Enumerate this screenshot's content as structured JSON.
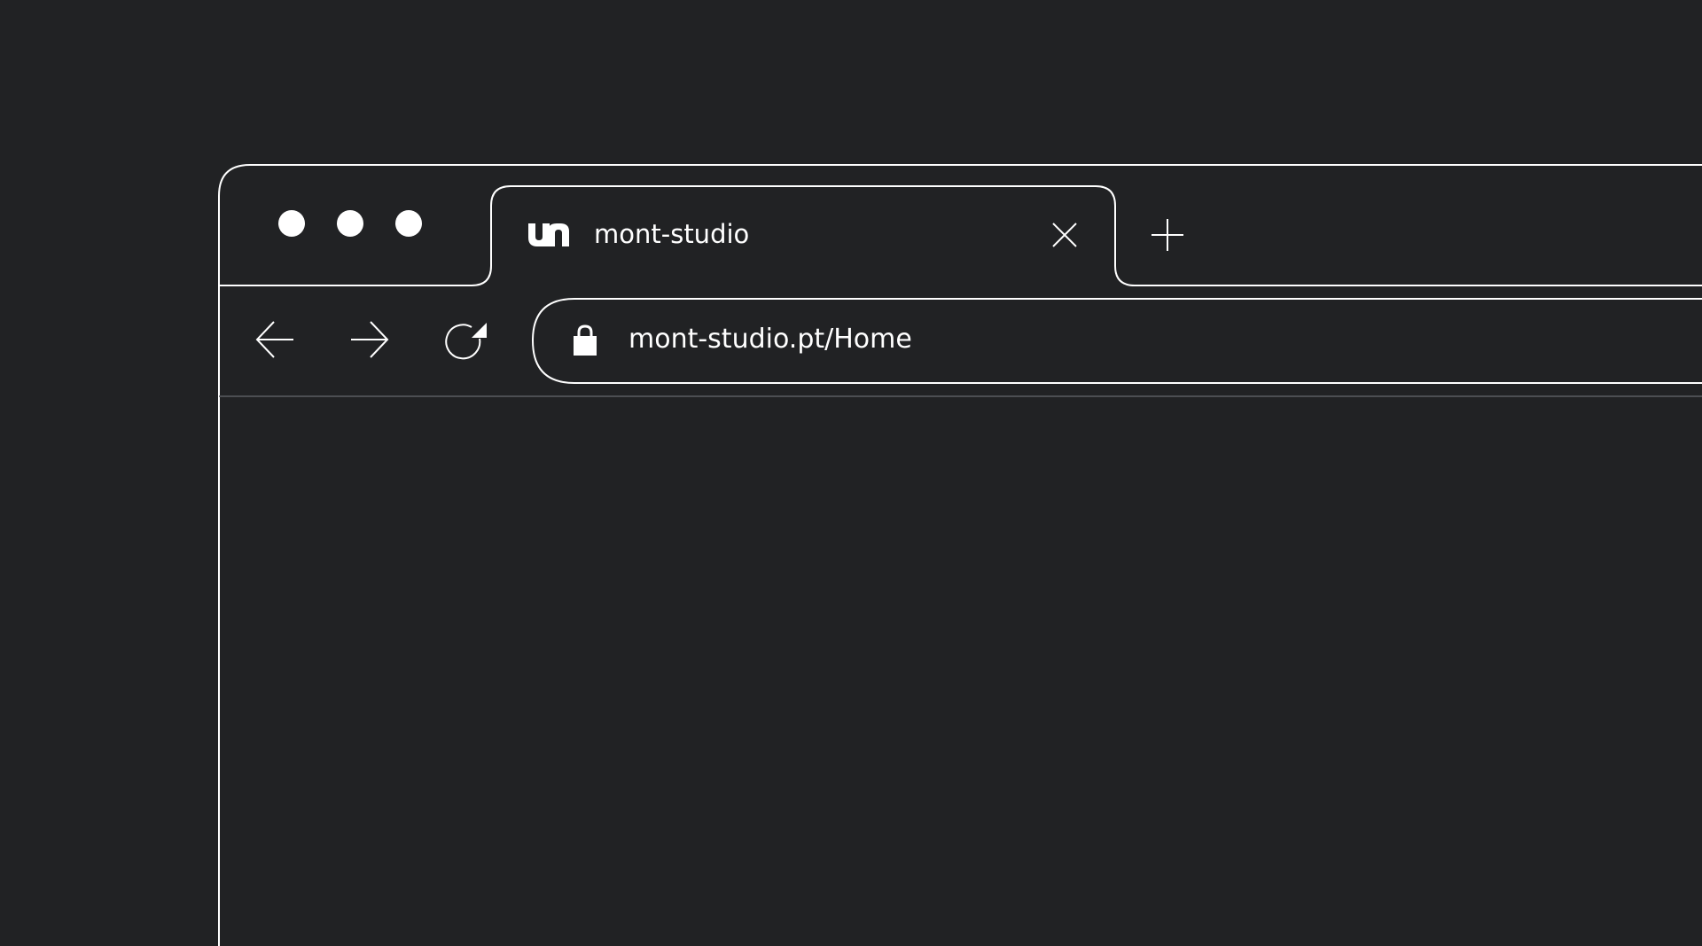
{
  "colors": {
    "background": "#212224",
    "stroke": "#ffffff",
    "divider": "#5b5d61"
  },
  "window_controls": [
    "close-dot",
    "minimize-dot",
    "zoom-dot"
  ],
  "tabs": [
    {
      "label": "mont-studio",
      "favicon": "mont-studio-logo-icon",
      "close_icon": "close-icon",
      "active": true
    }
  ],
  "new_tab_icon": "plus-icon",
  "toolbar": {
    "back_icon": "arrow-left-icon",
    "forward_icon": "arrow-right-icon",
    "reload_icon": "reload-icon"
  },
  "address_bar": {
    "secure_icon": "lock-icon",
    "url": "mont-studio.pt/Home"
  }
}
